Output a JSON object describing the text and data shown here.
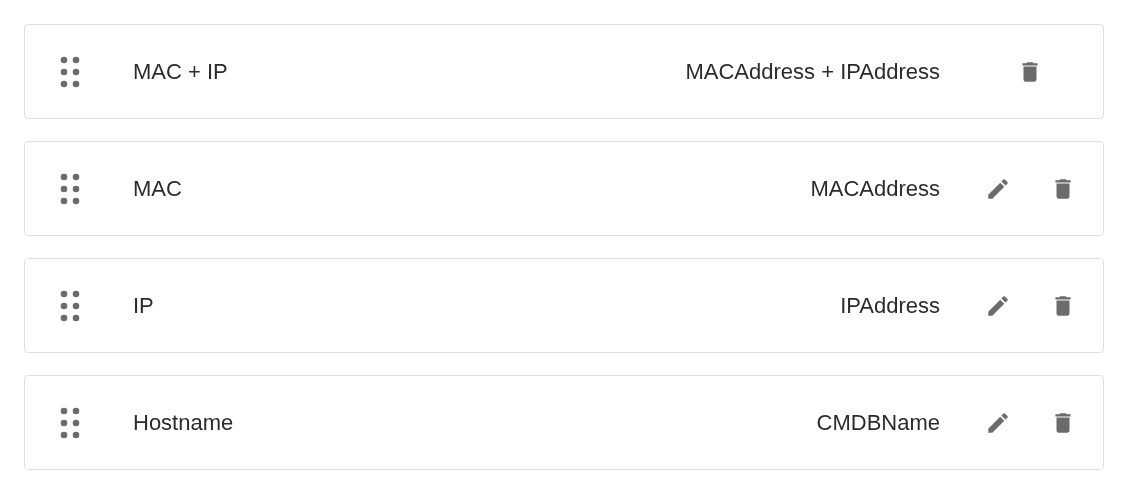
{
  "rows": [
    {
      "label": "MAC + IP",
      "value": "MACAddress + IPAddress",
      "editable": false
    },
    {
      "label": "MAC",
      "value": "MACAddress",
      "editable": true
    },
    {
      "label": "IP",
      "value": "IPAddress",
      "editable": true
    },
    {
      "label": "Hostname",
      "value": "CMDBName",
      "editable": true
    }
  ]
}
